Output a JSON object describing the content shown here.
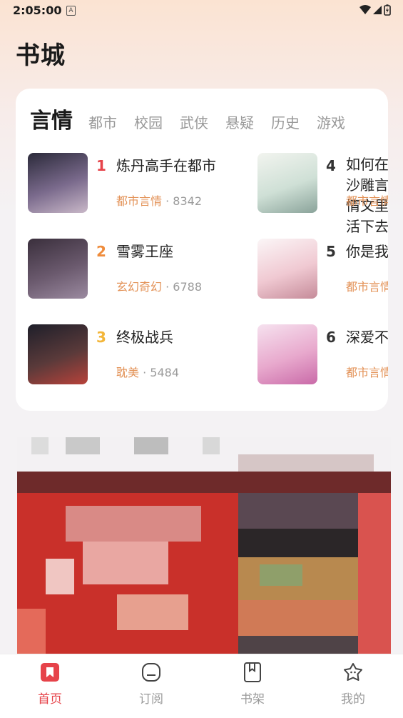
{
  "status_bar": {
    "time": "2:05:00",
    "notification_icon": "a-letter-icon",
    "icons": [
      "wifi-icon",
      "cellular-icon",
      "battery-icon"
    ]
  },
  "page": {
    "title": "书城"
  },
  "ranking": {
    "active_tab": "言情",
    "tabs": [
      "都市",
      "校园",
      "武侠",
      "悬疑",
      "历史",
      "游戏"
    ],
    "books": [
      {
        "rank": "1",
        "rank_color": "#e6434a",
        "title": "炼丹高手在都市",
        "genre": "都市言情",
        "separator": " · ",
        "count": "8342",
        "cover": [
          "#2b2a3a",
          "#7a6a8c",
          "#c9b8c8"
        ]
      },
      {
        "rank": "2",
        "rank_color": "#ef8c3c",
        "title": "雪雾王座",
        "genre": "玄幻奇幻",
        "separator": " · ",
        "count": "6788",
        "cover": [
          "#3a2f3c",
          "#6b5a6e",
          "#9b8aa0"
        ]
      },
      {
        "rank": "3",
        "rank_color": "#f3b63a",
        "title": "终极战兵",
        "genre": "耽美",
        "separator": " · ",
        "count": "5484",
        "cover": [
          "#1e1f2a",
          "#5a3a3a",
          "#b8423a"
        ]
      },
      {
        "rank": "4",
        "rank_color": "#333333",
        "title": "如何在沙雕言情文里活下去",
        "genre": "都市言情",
        "separator": "",
        "count": "",
        "cover": [
          "#f2f4ef",
          "#cfe0d6",
          "#8aa39a"
        ]
      },
      {
        "rank": "5",
        "rank_color": "#333333",
        "title": "你是我的",
        "genre": "都市言情",
        "separator": "",
        "count": "",
        "cover": [
          "#fbf6f7",
          "#f0c9d2",
          "#c58b99"
        ]
      },
      {
        "rank": "6",
        "rank_color": "#333333",
        "title": "深爱不言情",
        "genre": "都市言情",
        "separator": "",
        "count": "",
        "cover": [
          "#f6e2ef",
          "#e8a9cd",
          "#c96aa8"
        ]
      }
    ]
  },
  "bottom_nav": [
    {
      "label": "首页",
      "icon": "bookmark-home-icon",
      "active": true
    },
    {
      "label": "订阅",
      "icon": "inbox-icon",
      "active": false
    },
    {
      "label": "书架",
      "icon": "book-icon",
      "active": false
    },
    {
      "label": "我的",
      "icon": "star-face-icon",
      "active": false
    }
  ],
  "colors": {
    "accent": "#e6434a",
    "genre_text": "#e39257",
    "muted": "#9a9a9a"
  }
}
